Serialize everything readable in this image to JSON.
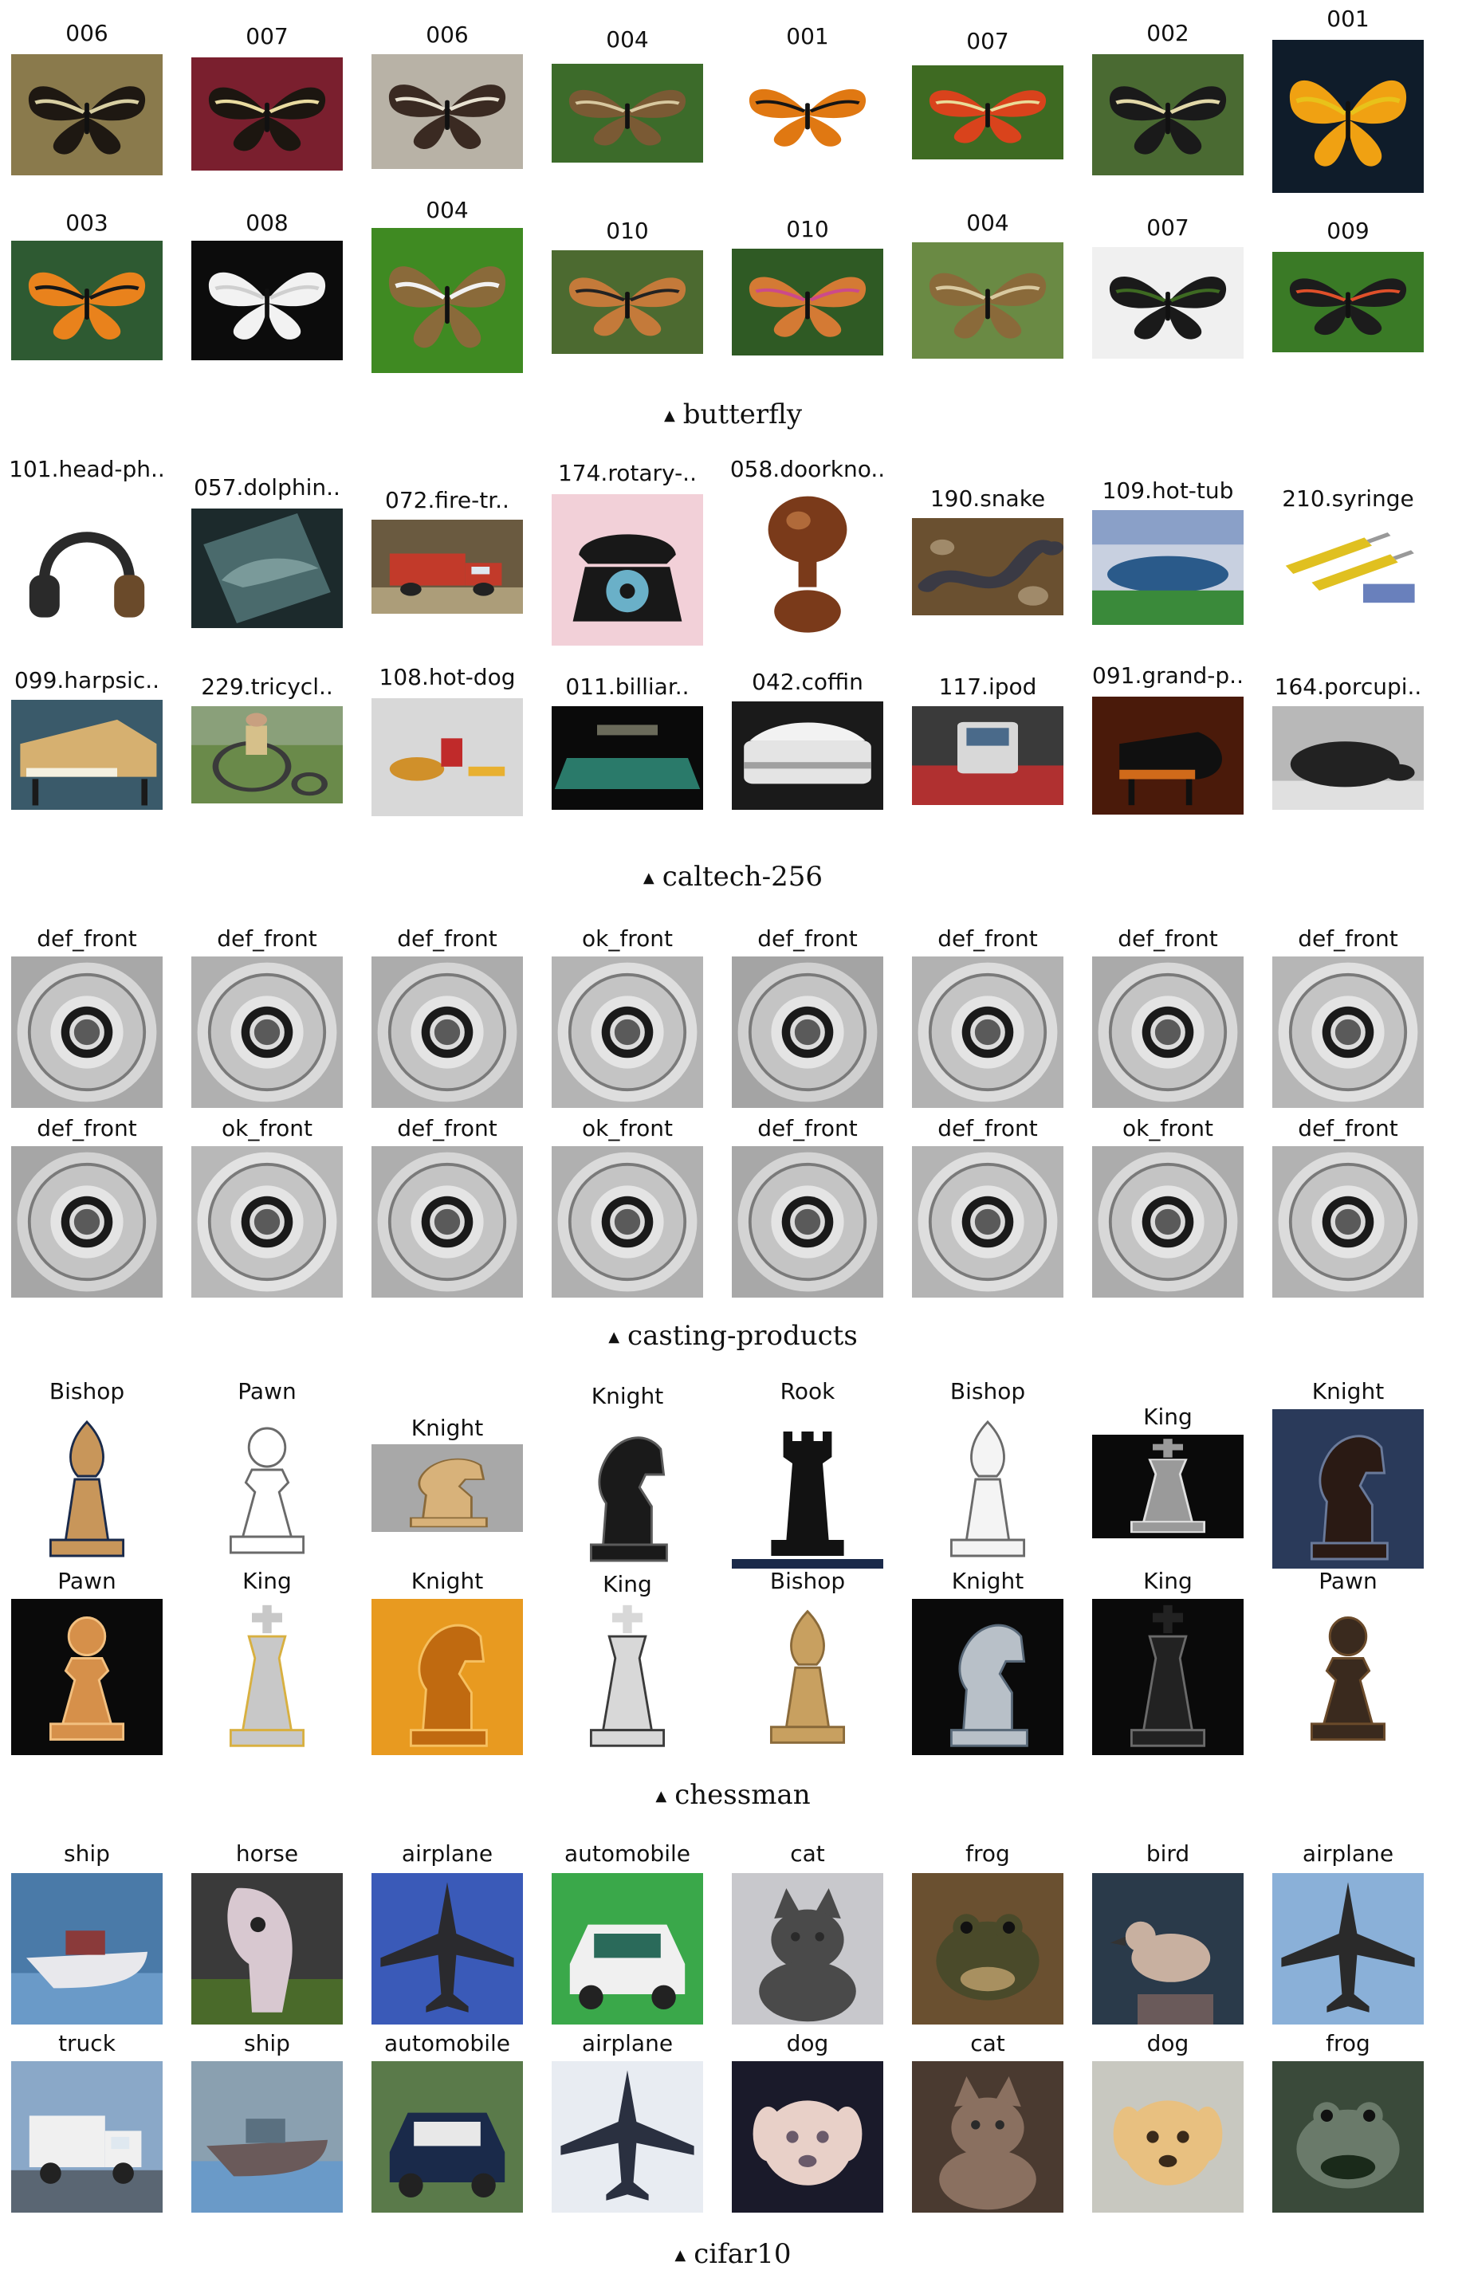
{
  "sections": [
    {
      "id": "butterfly",
      "caption": "butterfly",
      "rows": [
        [
          {
            "label": "006",
            "icon": "butterfly",
            "colors": [
              "#8a7a4c",
              "#1e1812",
              "#d8cfa2"
            ]
          },
          {
            "label": "007",
            "icon": "butterfly",
            "colors": [
              "#7a1f2e",
              "#1c1610",
              "#eadca0"
            ]
          },
          {
            "label": "006",
            "icon": "butterfly",
            "colors": [
              "#b8b2a6",
              "#3a2a22",
              "#e8e2d2"
            ]
          },
          {
            "label": "004",
            "icon": "butterfly",
            "colors": [
              "#3c6b2a",
              "#7a5a34",
              "#d8c9a0"
            ]
          },
          {
            "label": "001",
            "icon": "butterfly",
            "colors": [
              "#ffffff",
              "#e07812",
              "#151515"
            ]
          },
          {
            "label": "007",
            "icon": "butterfly",
            "colors": [
              "#3e6a22",
              "#d9431c",
              "#eadc9a"
            ]
          },
          {
            "label": "002",
            "icon": "butterfly",
            "colors": [
              "#4a6a32",
              "#1a1a1a",
              "#e2d8a8"
            ]
          },
          {
            "label": "001",
            "icon": "butterfly",
            "colors": [
              "#0f1c2a",
              "#f0a112",
              "#e8c21a"
            ]
          }
        ],
        [
          {
            "label": "003",
            "icon": "butterfly",
            "colors": [
              "#2e5a32",
              "#e9821c",
              "#181818"
            ]
          },
          {
            "label": "008",
            "icon": "butterfly",
            "colors": [
              "#0c0c0c",
              "#f2f2f2",
              "#cfcfcf"
            ]
          },
          {
            "label": "004",
            "icon": "butterfly",
            "colors": [
              "#3f8a22",
              "#8a6a3a",
              "#f2f2f2"
            ]
          },
          {
            "label": "010",
            "icon": "butterfly",
            "colors": [
              "#4c6a30",
              "#c47a3a",
              "#222222"
            ]
          },
          {
            "label": "010",
            "icon": "butterfly",
            "colors": [
              "#2f5a24",
              "#d47a34",
              "#cc4a8a"
            ]
          },
          {
            "label": "004",
            "icon": "butterfly",
            "colors": [
              "#6a8a44",
              "#8a6a3a",
              "#d8c9a0"
            ]
          },
          {
            "label": "007",
            "icon": "butterfly",
            "colors": [
              "#f0f0f0",
              "#1a1a1a",
              "#3e6a22"
            ]
          },
          {
            "label": "009",
            "icon": "butterfly",
            "colors": [
              "#3a7a26",
              "#1c1c1c",
              "#e0502a"
            ]
          }
        ]
      ]
    },
    {
      "id": "caltech",
      "caption": "caltech-256",
      "rows": [
        [
          {
            "label": "101.head-ph..",
            "icon": "headphones",
            "colors": [
              "#ffffff",
              "#2a2a2a",
              "#6a4a2a"
            ]
          },
          {
            "label": "057.dolphin..",
            "icon": "dolphin",
            "colors": [
              "#1c2a2c",
              "#4a6a6c",
              "#7a9a9a"
            ]
          },
          {
            "label": "072.fire-tr..",
            "icon": "truck",
            "colors": [
              "#6a5a40",
              "#c23a2a",
              "#d9c9a0"
            ]
          },
          {
            "label": "174.rotary-..",
            "icon": "phone",
            "colors": [
              "#f2d0d8",
              "#181818",
              "#6ab0c8"
            ]
          },
          {
            "label": "058.doorkno..",
            "icon": "knob",
            "colors": [
              "#ffffff",
              "#7a3a1a",
              "#b06a3a"
            ]
          },
          {
            "label": "190.snake",
            "icon": "snake",
            "colors": [
              "#6a5030",
              "#3a3a44",
              "#a08a6a"
            ]
          },
          {
            "label": "109.hot-tub",
            "icon": "tub",
            "colors": [
              "#c8d0e0",
              "#2a5a8a",
              "#3a8a3a"
            ]
          },
          {
            "label": "210.syringe",
            "icon": "syringe",
            "colors": [
              "#ffffff",
              "#e0c020",
              "#2a4aa0"
            ]
          }
        ],
        [
          {
            "label": "099.harpsic..",
            "icon": "harpsichord",
            "colors": [
              "#3a5a6a",
              "#d6b070",
              "#1a1a1a"
            ]
          },
          {
            "label": "229.tricycl..",
            "icon": "tricycle",
            "colors": [
              "#6a8a4a",
              "#d6c08a",
              "#3a3a3a"
            ]
          },
          {
            "label": "108.hot-dog",
            "icon": "hotdog",
            "colors": [
              "#d8d8d8",
              "#d0902a",
              "#c02a2a"
            ]
          },
          {
            "label": "011.billiar..",
            "icon": "billiard",
            "colors": [
              "#0a0a0a",
              "#2a7a6a",
              "#6a6a5a"
            ]
          },
          {
            "label": "042.coffin",
            "icon": "coffin",
            "colors": [
              "#1a1a1a",
              "#e4e4e4",
              "#a0a0a0"
            ]
          },
          {
            "label": "117.ipod",
            "icon": "ipod",
            "colors": [
              "#3a3a3a",
              "#b03030",
              "#d8d8d8"
            ]
          },
          {
            "label": "091.grand-p..",
            "icon": "piano",
            "colors": [
              "#4a1a0a",
              "#d06a1a",
              "#101010"
            ]
          },
          {
            "label": "164.porcupi..",
            "icon": "porcupine",
            "colors": [
              "#b8b8b8",
              "#222222",
              "#e0e0e0"
            ]
          }
        ]
      ]
    },
    {
      "id": "casting",
      "caption": "casting-products",
      "rows": [
        [
          {
            "label": "def_front",
            "icon": "disc",
            "colors": [
              "#a8a8a8",
              "#d6d6d6",
              "#1a1a1a"
            ]
          },
          {
            "label": "def_front",
            "icon": "disc",
            "colors": [
              "#b0b0b0",
              "#dadada",
              "#1a1a1a"
            ]
          },
          {
            "label": "def_front",
            "icon": "disc",
            "colors": [
              "#acacac",
              "#d4d4d4",
              "#1a1a1a"
            ]
          },
          {
            "label": "ok_front",
            "icon": "disc",
            "colors": [
              "#b4b4b4",
              "#dedede",
              "#1a1a1a"
            ]
          },
          {
            "label": "def_front",
            "icon": "disc",
            "colors": [
              "#a4a4a4",
              "#d0d0d0",
              "#1a1a1a"
            ]
          },
          {
            "label": "def_front",
            "icon": "disc",
            "colors": [
              "#b2b2b2",
              "#dcdcdc",
              "#1a1a1a"
            ]
          },
          {
            "label": "def_front",
            "icon": "disc",
            "colors": [
              "#aaaaaa",
              "#d8d8d8",
              "#1a1a1a"
            ]
          },
          {
            "label": "def_front",
            "icon": "disc",
            "colors": [
              "#b6b6b6",
              "#e0e0e0",
              "#1a1a1a"
            ]
          }
        ],
        [
          {
            "label": "def_front",
            "icon": "disc",
            "colors": [
              "#a6a6a6",
              "#d2d2d2",
              "#1a1a1a"
            ]
          },
          {
            "label": "ok_front",
            "icon": "disc",
            "colors": [
              "#b8b8b8",
              "#e2e2e2",
              "#1a1a1a"
            ]
          },
          {
            "label": "def_front",
            "icon": "disc",
            "colors": [
              "#aeaeae",
              "#d6d6d6",
              "#1a1a1a"
            ]
          },
          {
            "label": "ok_front",
            "icon": "disc",
            "colors": [
              "#b0b0b0",
              "#dadada",
              "#1a1a1a"
            ]
          },
          {
            "label": "def_front",
            "icon": "disc",
            "colors": [
              "#a8a8a8",
              "#d4d4d4",
              "#1a1a1a"
            ]
          },
          {
            "label": "def_front",
            "icon": "disc",
            "colors": [
              "#b4b4b4",
              "#dedede",
              "#1a1a1a"
            ]
          },
          {
            "label": "ok_front",
            "icon": "disc",
            "colors": [
              "#acacac",
              "#d8d8d8",
              "#1a1a1a"
            ]
          },
          {
            "label": "def_front",
            "icon": "disc",
            "colors": [
              "#b2b2b2",
              "#dcdcdc",
              "#1a1a1a"
            ]
          }
        ]
      ]
    },
    {
      "id": "chessman",
      "caption": "chessman",
      "rows": [
        [
          {
            "label": "Bishop",
            "icon": "bishop",
            "colors": [
              "#ffffff",
              "#c8965a",
              "#1a2a4a"
            ]
          },
          {
            "label": "Pawn",
            "icon": "pawn",
            "colors": [
              "#ffffff",
              "#ffffff",
              "#6a6a6a"
            ]
          },
          {
            "label": "Knight",
            "icon": "knight",
            "colors": [
              "#a8a8a8",
              "#d8b27a",
              "#8a6a3a"
            ]
          },
          {
            "label": "Knight",
            "icon": "knight",
            "colors": [
              "#ffffff",
              "#1a1a1a",
              "#5a5a5a"
            ]
          },
          {
            "label": "Rook",
            "icon": "rook",
            "colors": [
              "#ffffff",
              "#121212",
              "#1a2a4a"
            ]
          },
          {
            "label": "Bishop",
            "icon": "bishop",
            "colors": [
              "#ffffff",
              "#f4f4f4",
              "#6a6a6a"
            ]
          },
          {
            "label": "King",
            "icon": "king",
            "colors": [
              "#0a0a0a",
              "#9a9a9a",
              "#e0e0e0"
            ]
          },
          {
            "label": "Knight",
            "icon": "knight",
            "colors": [
              "#2a3a5a",
              "#2a1a14",
              "#6a7a9a"
            ]
          }
        ],
        [
          {
            "label": "Pawn",
            "icon": "pawn",
            "colors": [
              "#0a0a0a",
              "#d6904a",
              "#f2c080"
            ]
          },
          {
            "label": "King",
            "icon": "king",
            "colors": [
              "#ffffff",
              "#c8c8c8",
              "#d8b040"
            ]
          },
          {
            "label": "Knight",
            "icon": "knight",
            "colors": [
              "#e89a20",
              "#c06a10",
              "#f6c060"
            ]
          },
          {
            "label": "King",
            "icon": "king",
            "colors": [
              "#ffffff",
              "#d8d8d8",
              "#3a3a3a"
            ]
          },
          {
            "label": "Bishop",
            "icon": "bishop",
            "colors": [
              "#ffffff",
              "#c8a060",
              "#8a6a3a"
            ]
          },
          {
            "label": "Knight",
            "icon": "knight",
            "colors": [
              "#0a0a0a",
              "#b8c0c8",
              "#5a6a7a"
            ]
          },
          {
            "label": "King",
            "icon": "king",
            "colors": [
              "#0a0a0a",
              "#222222",
              "#6a6a6a"
            ]
          },
          {
            "label": "Pawn",
            "icon": "pawn",
            "colors": [
              "#ffffff",
              "#3a2a1e",
              "#6a4a2a"
            ]
          }
        ]
      ]
    },
    {
      "id": "cifar10",
      "caption": "cifar10",
      "rows": [
        [
          {
            "label": "ship",
            "icon": "boat",
            "colors": [
              "#4a7aa8",
              "#e8e8ec",
              "#8a3a3a"
            ]
          },
          {
            "label": "horse",
            "icon": "horse",
            "colors": [
              "#3a3a3a",
              "#d8c8d0",
              "#4a6a2a"
            ]
          },
          {
            "label": "airplane",
            "icon": "airplane",
            "colors": [
              "#3a5ab8",
              "#2a2a2e",
              "#6a7a9a"
            ]
          },
          {
            "label": "automobile",
            "icon": "car",
            "colors": [
              "#3aa84a",
              "#f0f0f0",
              "#2a6a5a"
            ]
          },
          {
            "label": "cat",
            "icon": "cat",
            "colors": [
              "#c8c8cc",
              "#4a4a4a",
              "#2a2a2a"
            ]
          },
          {
            "label": "frog",
            "icon": "frog",
            "colors": [
              "#6a5030",
              "#4a4a2a",
              "#a89060"
            ]
          },
          {
            "label": "bird",
            "icon": "bird",
            "colors": [
              "#2a3a4a",
              "#c8b0a0",
              "#6a5a5a"
            ]
          },
          {
            "label": "airplane",
            "icon": "airplane",
            "colors": [
              "#8ab0d8",
              "#2a2a2a",
              "#c0a890"
            ]
          }
        ],
        [
          {
            "label": "truck",
            "icon": "truck",
            "colors": [
              "#8aa8c8",
              "#f0f0f0",
              "#3a3a3a"
            ]
          },
          {
            "label": "ship",
            "icon": "boat",
            "colors": [
              "#8aa0b0",
              "#6a5a5a",
              "#5a7080"
            ]
          },
          {
            "label": "automobile",
            "icon": "car",
            "colors": [
              "#5a7a4a",
              "#1a2a4a",
              "#e8e8e8"
            ]
          },
          {
            "label": "airplane",
            "icon": "airplane",
            "colors": [
              "#e8ecf2",
              "#2a3040",
              "#b8c0cc"
            ]
          },
          {
            "label": "dog",
            "icon": "dog",
            "colors": [
              "#1a1a2a",
              "#e8d0c8",
              "#6a5a6a"
            ]
          },
          {
            "label": "cat",
            "icon": "cat",
            "colors": [
              "#4a3a30",
              "#8a7060",
              "#2a2a2a"
            ]
          },
          {
            "label": "dog",
            "icon": "dog",
            "colors": [
              "#c8c8c0",
              "#e8c080",
              "#3a2a1a"
            ]
          },
          {
            "label": "frog",
            "icon": "frog",
            "colors": [
              "#3a4a3a",
              "#6a7a6a",
              "#1a2a1a"
            ]
          }
        ]
      ]
    }
  ]
}
